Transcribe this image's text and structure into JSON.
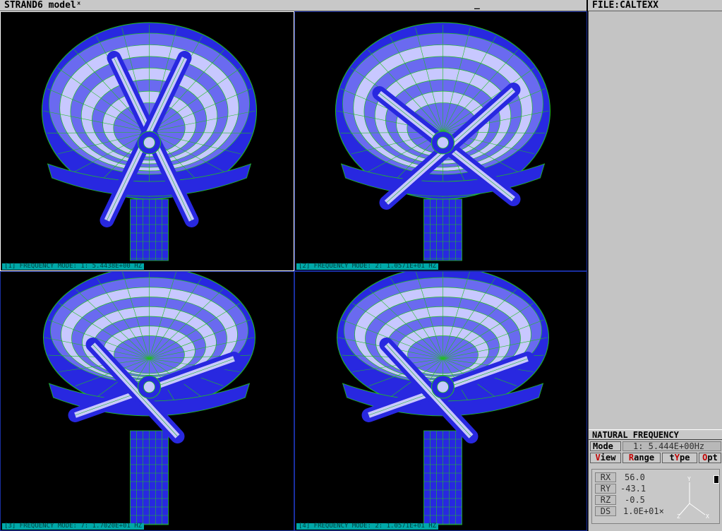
{
  "app": {
    "title": "STRAND6 modelˣ",
    "cursor": "_",
    "file_label": "FILE:CALTEXX"
  },
  "viewports": [
    {
      "label": "[1] FREQUENCY MODE: 1: 5.4438E+00 HZ",
      "active": true
    },
    {
      "label": "[2] FREQUENCY MODE: 2: 1.0571E+01 HZ",
      "active": false
    },
    {
      "label": "[3] FREQUENCY MODE: 7: 1.7020E+01 HZ",
      "active": false
    },
    {
      "label": "[4] FREQUENCY MODE: 2: 1.0571E+01 HZ",
      "active": false
    }
  ],
  "panel": {
    "title": "NATURAL FREQUENCY",
    "mode_label": "Mode",
    "mode_value": "1: 5.444E+00Hz",
    "menu": [
      {
        "hot": "V",
        "rest": "iew"
      },
      {
        "hot": "R",
        "rest": "ange"
      },
      {
        "pre": "t",
        "hot": "Y",
        "rest": "pe"
      },
      {
        "hot": "O",
        "rest": "pt"
      }
    ],
    "readout": [
      {
        "key": "RX",
        "value": "56.0"
      },
      {
        "key": "RY",
        "value": "-43.1"
      },
      {
        "key": "RZ",
        "value": "-0.5"
      },
      {
        "key": "DS",
        "value": "1.0E+01×"
      }
    ],
    "axes": {
      "x": "X",
      "y": "Y",
      "z": "Z"
    }
  },
  "colors": {
    "mesh_dark": "#2828e0",
    "mesh_mid": "#6a6af0",
    "mesh_light": "#c8c8ff",
    "wire": "#20c020"
  }
}
